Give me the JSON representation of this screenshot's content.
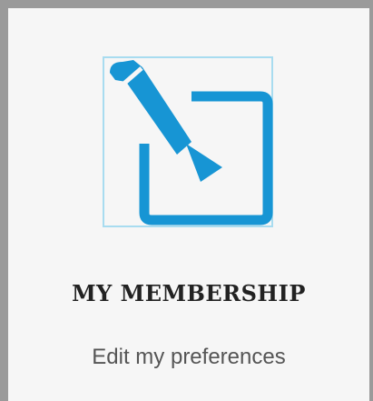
{
  "card": {
    "title": "MY MEMBERSHIP",
    "subtitle": "Edit my preferences",
    "icon": "edit-pencil-icon"
  },
  "colors": {
    "icon_blue": "#1795d4",
    "icon_frame": "#a8dcf0",
    "card_background": "#f6f6f6",
    "card_border": "#9a9a9a",
    "title_text": "#222222",
    "subtitle_text": "#555555"
  }
}
